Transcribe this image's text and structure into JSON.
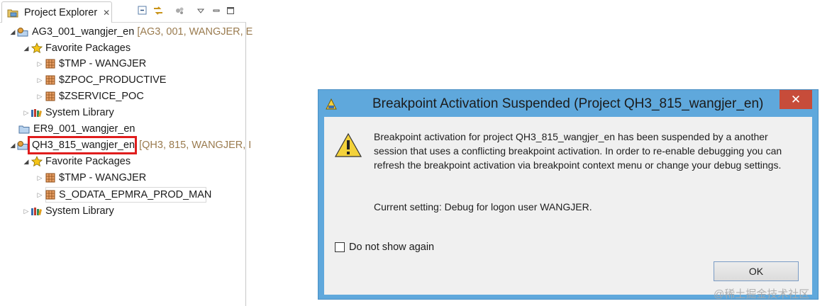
{
  "project_explorer": {
    "tab_title": "Project Explorer",
    "tree": [
      {
        "label": "AG3_001_wangjer_en",
        "decoration": "[AG3, 001, WANGJER, E"
      },
      {
        "label": "Favorite Packages"
      },
      {
        "label": "$TMP - WANGJER"
      },
      {
        "label": "$ZPOC_PRODUCTIVE"
      },
      {
        "label": "$ZSERVICE_POC"
      },
      {
        "label": "System Library"
      },
      {
        "label": "ER9_001_wangjer_en"
      },
      {
        "label": "QH3_815_wangjer_en",
        "decoration": "[QH3, 815, WANGJER, I"
      },
      {
        "label": "Favorite Packages"
      },
      {
        "label": "$TMP - WANGJER"
      },
      {
        "label": "S_ODATA_EPMRA_PROD_MAN"
      },
      {
        "label": "System Library"
      }
    ]
  },
  "dialog": {
    "title": "Breakpoint Activation Suspended (Project QH3_815_wangjer_en)",
    "message": "Breakpoint activation for project QH3_815_wangjer_en has been suspended by a another session that uses a conflicting breakpoint activation. In order to re-enable debugging you can refresh the breakpoint activation via breakpoint context menu or change your debug settings.",
    "current_setting": "Current setting: Debug for logon user WANGJER.",
    "checkbox_label": "Do not show again",
    "checkbox_checked": false,
    "ok_label": "OK"
  },
  "watermark": "@稀土掘金技术社区",
  "colors": {
    "dialog_frame": "#5fa8dc",
    "close_button": "#c74c3a",
    "highlight_box": "#e01d1d",
    "decoration_text": "#9a7b4f"
  }
}
